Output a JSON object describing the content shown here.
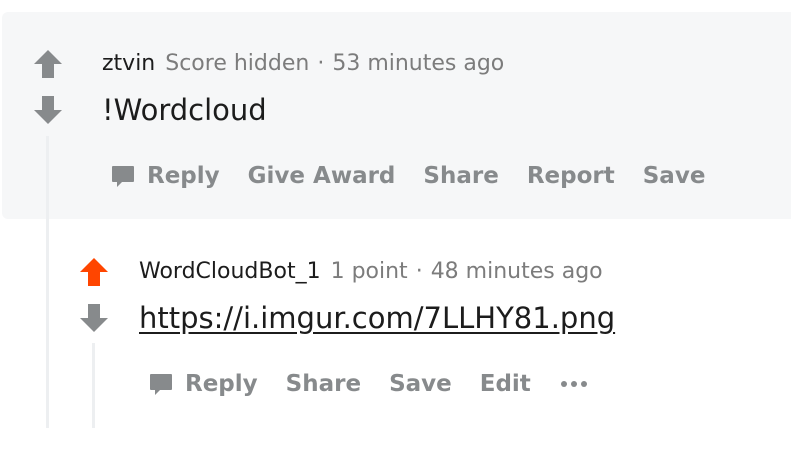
{
  "colors": {
    "upvote_active": "#ff4500",
    "vote_inactive": "#878a8c",
    "action_text": "#878a8c",
    "meta_text": "#7c7c7c",
    "highlight_bg": "#f6f7f8"
  },
  "parent_comment": {
    "author": "ztvin",
    "score": "Score hidden",
    "separator": "·",
    "time": "53 minutes ago",
    "body": "!Wordcloud",
    "actions": {
      "reply": "Reply",
      "give_award": "Give Award",
      "share": "Share",
      "report": "Report",
      "save": "Save"
    },
    "upvote_icon": "arrow-up-icon",
    "downvote_icon": "arrow-down-icon"
  },
  "reply_comment": {
    "author": "WordCloudBot_1",
    "score": "1 point",
    "separator": "·",
    "time": "48 minutes ago",
    "link": "https://i.imgur.com/7LLHY81.png",
    "actions": {
      "reply": "Reply",
      "share": "Share",
      "save": "Save",
      "edit": "Edit"
    },
    "upvote_state": "active",
    "more_icon": "more-options-icon"
  }
}
